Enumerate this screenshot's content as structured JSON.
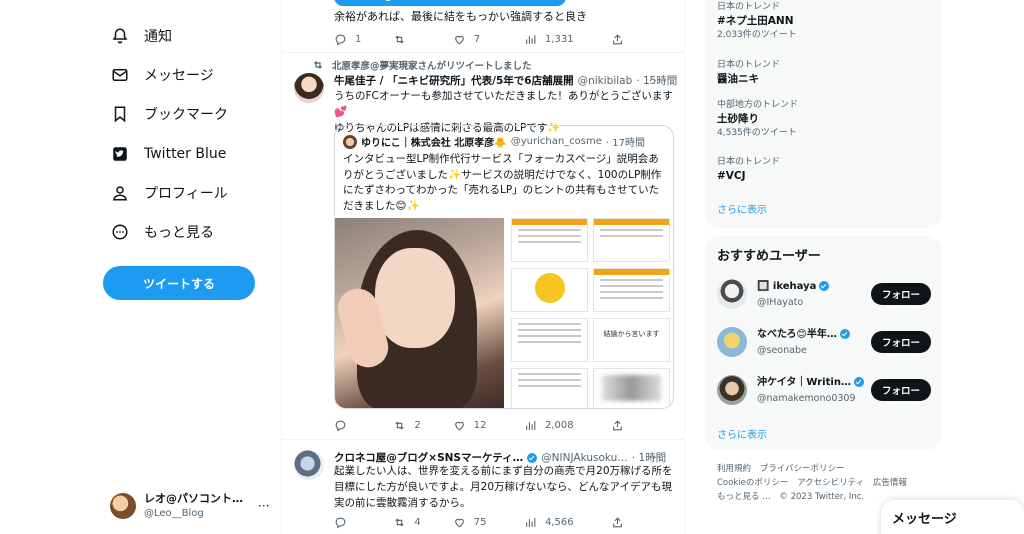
{
  "nav": {
    "items": [
      {
        "label": "通知",
        "icon": "bell-icon"
      },
      {
        "label": "メッセージ",
        "icon": "envelope-icon"
      },
      {
        "label": "ブックマーク",
        "icon": "bookmark-icon"
      },
      {
        "label": "Twitter Blue",
        "icon": "twitter-blue-icon"
      },
      {
        "label": "プロフィール",
        "icon": "person-icon"
      },
      {
        "label": "もっと見る",
        "icon": "more-circle-icon"
      }
    ],
    "tweet_button": "ツイートする"
  },
  "account": {
    "name": "レオ@パソコント…",
    "handle": "@Leo__Blog",
    "more": "···"
  },
  "timeline": {
    "prev_tweet": {
      "text": "余裕があれば、最後に結をもっかい強調すると良き",
      "stats": {
        "reply": "1",
        "retweet": "",
        "like": "7",
        "views": "1,331"
      }
    },
    "tweet1": {
      "retweeted_by": "北原孝彦@夢実現家さんがリツイートしました",
      "name": "牛尾佳子 / 「ニキビ研究所」代表/5年で6店舗展開",
      "handle": "@nikibilab",
      "time": "· 15時間",
      "more": "···",
      "text": "うちのFCオーナーも参加させていただきました！ありがとうございます💕\nゆりちゃんのLPは感情に刺さる最高のLPです✨",
      "quote": {
        "name": "ゆりにこ｜株式会社 北原孝彦🐥",
        "handle": "@yurichan_cosme",
        "time": "· 17時間",
        "text": "インタビュー型LP制作代行サービス「フォーカスページ」説明会ありがとうございました✨サービスの説明だけでなく、100のLP制作にたずさわってわかった「売れるLP」のヒントの共有もさせていただきました😊✨",
        "slide_captions": [
          "結論から言います"
        ]
      },
      "stats": {
        "reply": "",
        "retweet": "2",
        "like": "12",
        "views": "2,008"
      }
    },
    "tweet2": {
      "name": "クロネコ屋@ブログ×SNSマーケティ…",
      "handle": "@NINJAkusoku…",
      "time": "· 1時間",
      "more": "···",
      "text": "起業したい人は、世界を変える前にまず自分の商売で月20万稼げる所を目標にした方が良いですよ。月20万稼げないなら、どんなアイデアも現実の前に雲散霧消するから。",
      "stats": {
        "reply": "",
        "retweet": "4",
        "like": "75",
        "views": "4,566"
      }
    }
  },
  "trends": {
    "items": [
      {
        "context": "日本のトレンド",
        "name": "#ネプ土田ANN",
        "count": "2,033件のツイート"
      },
      {
        "context": "日本のトレンド",
        "name": "醤油ニキ",
        "count": ""
      },
      {
        "context": "中部地方のトレンド",
        "name": "土砂降り",
        "count": "4,535件のツイート"
      },
      {
        "context": "日本のトレンド",
        "name": "#VCJ",
        "count": ""
      }
    ],
    "show_more": "さらに表示"
  },
  "suggestions": {
    "title": "おすすめユーザー",
    "users": [
      {
        "name": "🔲 ikehaya",
        "handle": "@IHayato",
        "follow": "フォロー"
      },
      {
        "name": "なべたろ😊半年…",
        "handle": "@seonabe",
        "follow": "フォロー"
      },
      {
        "name": "沖ケイタ｜Writin…",
        "handle": "@namakemono0309",
        "follow": "フォロー"
      }
    ],
    "show_more": "さらに表示"
  },
  "footer": {
    "links": [
      "利用規約",
      "プライバシーポリシー",
      "Cookieのポリシー",
      "アクセシビリティ",
      "広告情報",
      "もっと見る …"
    ],
    "copyright": "© 2023 Twitter, Inc."
  },
  "messages_drawer": {
    "title": "メッセージ"
  },
  "colors": {
    "accent": "#1d9bf0",
    "text": "#0f1419",
    "muted": "#536471",
    "panel": "#f7f9f9"
  }
}
